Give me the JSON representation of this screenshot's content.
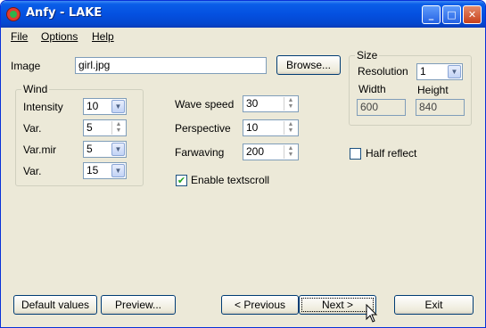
{
  "window": {
    "title": "Anfy - LAKE"
  },
  "titlebar": {
    "minimize_glyph": "_",
    "maximize_glyph": "□",
    "close_glyph": "✕"
  },
  "menu": {
    "file": "File",
    "options": "Options",
    "help": "Help"
  },
  "image": {
    "label": "Image",
    "value": "girl.jpg",
    "browse_label": "Browse..."
  },
  "wind": {
    "title": "Wind",
    "intensity": {
      "label": "Intensity",
      "value": "10"
    },
    "var1": {
      "label": "Var.",
      "value": "5"
    },
    "varmir": {
      "label": "Var.mir",
      "value": "5"
    },
    "var2": {
      "label": "Var.",
      "value": "15"
    }
  },
  "wave": {
    "speed": {
      "label": "Wave speed",
      "value": "30"
    },
    "perspective": {
      "label": "Perspective",
      "value": "10"
    },
    "farwaving": {
      "label": "Farwaving",
      "value": "200"
    },
    "textscroll": {
      "label": "Enable textscroll",
      "checked": true
    }
  },
  "size": {
    "title": "Size",
    "resolution_label": "Resolution",
    "resolution_value": "1",
    "width_label": "Width",
    "height_label": "Height",
    "width_value": "600",
    "height_value": "840"
  },
  "half_reflect": {
    "label": "Half reflect",
    "checked": false
  },
  "buttons": {
    "default": "Default values",
    "preview": "Preview...",
    "previous": "< Previous",
    "next": "Next >",
    "exit": "Exit"
  },
  "colors": {
    "titlebar": "#0450e0",
    "window_bg": "#ece9d8",
    "checkmark": "#21a121"
  }
}
